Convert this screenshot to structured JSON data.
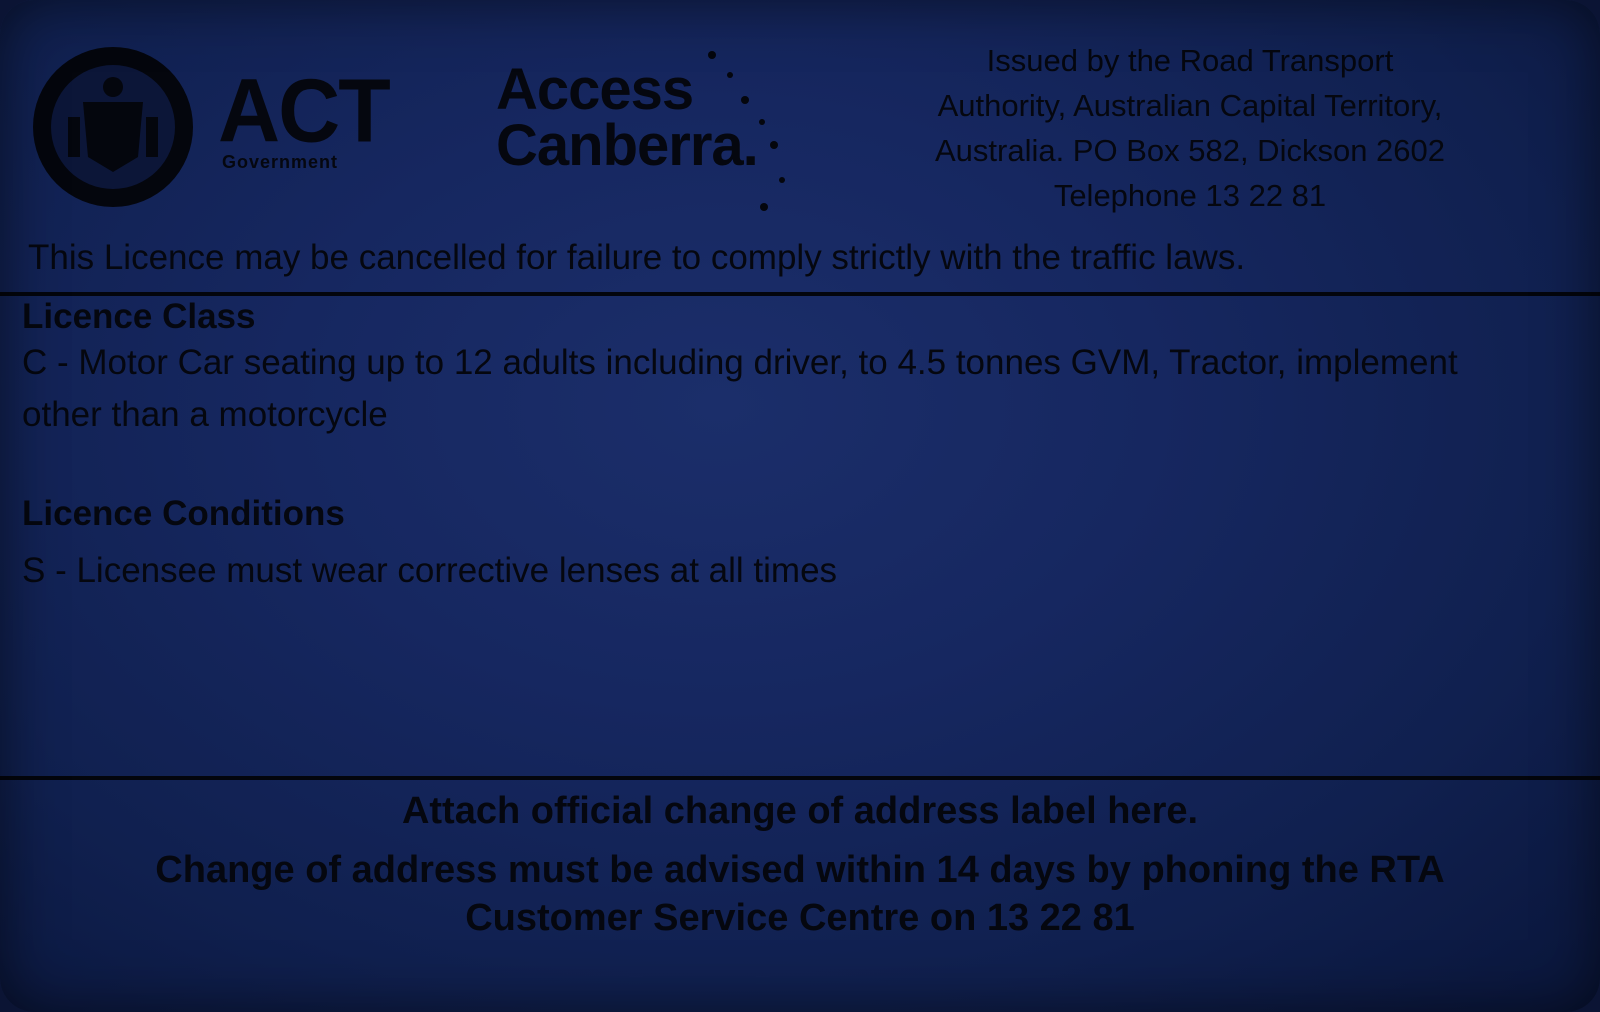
{
  "header": {
    "act_logo_word": "ACT",
    "act_logo_sub": "Government",
    "access_logo_line1": "Access",
    "access_logo_line2": "Canberra.",
    "issuer_line1": "Issued by the Road Transport",
    "issuer_line2": "Authority, Australian Capital Territory,",
    "issuer_line3": "Australia. PO Box 582, Dickson 2602",
    "issuer_line4": "Telephone 13 22 81"
  },
  "warning": "This Licence may be cancelled for failure to comply strictly with the traffic laws.",
  "licence_class": {
    "title": "Licence Class",
    "text": "C - Motor Car seating up to 12 adults including driver, to 4.5 tonnes GVM, Tractor, implement other than a motorcycle"
  },
  "licence_conditions": {
    "title": "Licence Conditions",
    "text": "S - Licensee must wear corrective lenses at all times"
  },
  "footer": {
    "line1": "Attach official change of address label here.",
    "line2": "Change of address must be advised within 14 days by phoning the RTA",
    "line3": "Customer Service Centre on 13 22 81"
  },
  "colors": {
    "card_background": "#162760",
    "text": "#05070f"
  }
}
